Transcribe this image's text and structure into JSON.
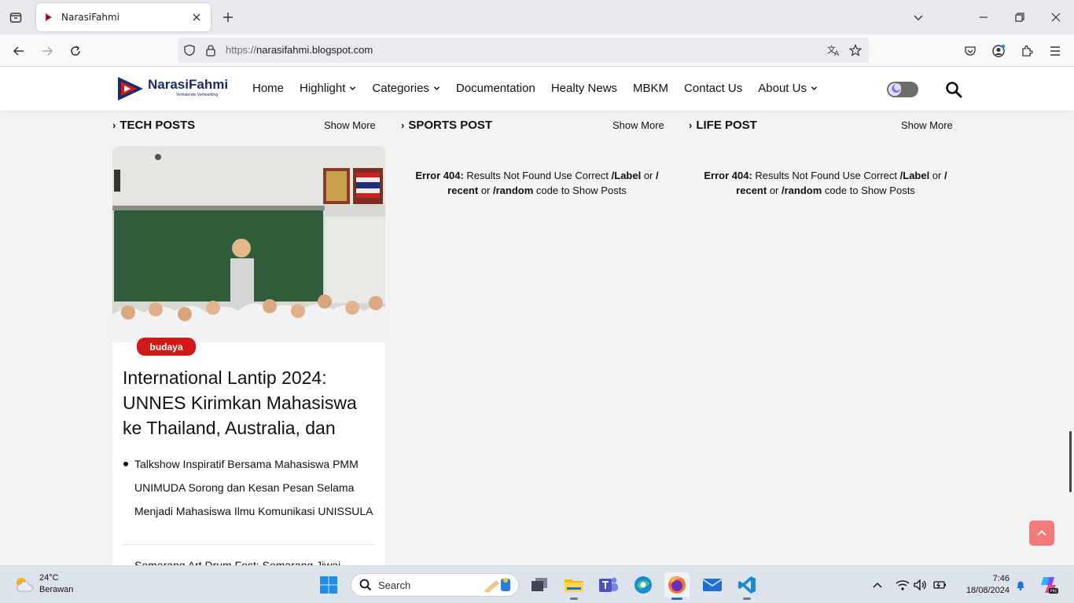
{
  "browser": {
    "tab_title": "NarasiFahmi",
    "url_protocol": "https://",
    "url_host": "narasifahmi.blogspot.com"
  },
  "site": {
    "brand": "NarasiFahmi",
    "tagline": "Verhalende Verbeelding",
    "menu": [
      {
        "label": "Home",
        "dropdown": false
      },
      {
        "label": "Highlight",
        "dropdown": true
      },
      {
        "label": "Categories",
        "dropdown": true
      },
      {
        "label": "Documentation",
        "dropdown": false
      },
      {
        "label": "Healty News",
        "dropdown": false
      },
      {
        "label": "MBKM",
        "dropdown": false
      },
      {
        "label": "Contact Us",
        "dropdown": false
      },
      {
        "label": "About Us",
        "dropdown": true
      }
    ],
    "accent_color": "#d01a1a"
  },
  "sections": [
    {
      "title": "TECH POSTS",
      "show_more": "Show More"
    },
    {
      "title": "SPORTS POST",
      "show_more": "Show More"
    },
    {
      "title": "LIFE POST",
      "show_more": "Show More"
    }
  ],
  "tech_post": {
    "badge": "budaya",
    "title": "International Lantip 2024: UNNES Kirimkan Mahasiswa ke Thailand, Australia, dan",
    "related_1": "Talkshow Inspiratif Bersama Mahasiswa PMM UNIMUDA Sorong dan Kesan Pesan Selama Menjadi Mahasiswa Ilmu Komunikasi UNISSULA",
    "related_2": "Semarang Art Drum Fest: Semarang Jiwai..."
  },
  "error": {
    "prefix": "Error 404:",
    "part1": " Results Not Found Use Correct ",
    "label_code": "/Label",
    "or1": " or ",
    "recent_code": "/ recent",
    "or2": " or ",
    "random_code": "/random",
    "suffix": " code to Show Posts"
  },
  "taskbar": {
    "temperature": "24°C",
    "weather": "Berawan",
    "search_label": "Search",
    "time": "7:46",
    "date": "18/08/2024"
  }
}
